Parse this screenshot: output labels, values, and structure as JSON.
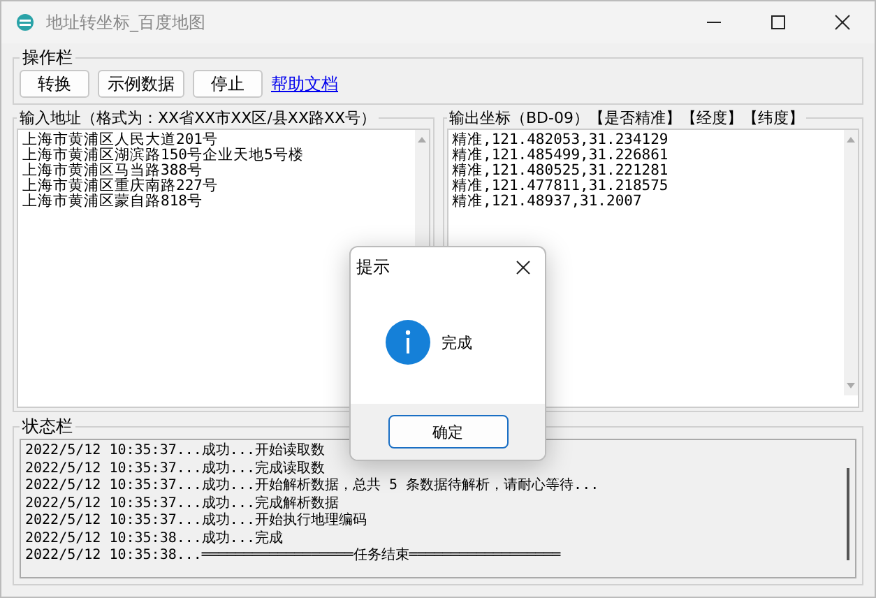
{
  "window": {
    "title": "地址转坐标_百度地图"
  },
  "toolbar": {
    "title": "操作栏",
    "buttons": [
      "转换",
      "示例数据",
      "停止"
    ],
    "link": "帮助文档"
  },
  "input": {
    "title": "输入地址（格式为：XX省XX市XX区/县XX路XX号）",
    "lines": [
      "上海市黄浦区人民大道201号",
      "上海市黄浦区湖滨路150号企业天地5号楼",
      "上海市黄浦区马当路388号",
      "上海市黄浦区重庆南路227号",
      "上海市黄浦区蒙自路818号"
    ]
  },
  "output": {
    "title": "输出坐标（BD-09）【是否精准】【经度】【纬度】",
    "lines": [
      "精准,121.482053,31.234129",
      "精准,121.485499,31.226861",
      "精准,121.480525,31.221281",
      "精准,121.477811,31.218575",
      "精准,121.48937,31.2007"
    ]
  },
  "status": {
    "title": "状态栏",
    "lines": [
      "2022/5/12 10:35:37...成功...开始读取数",
      "2022/5/12 10:35:37...成功...完成读取数",
      "2022/5/12 10:35:37...成功...开始解析数据，总共 5 条数据待解析，请耐心等待...",
      "2022/5/12 10:35:37...成功...完成解析数据",
      "2022/5/12 10:35:37...成功...开始执行地理编码",
      "2022/5/12 10:35:38...成功...完成",
      "2022/5/12 10:35:38...══════════════════任务结束══════════════════"
    ]
  },
  "dialog": {
    "title": "提示",
    "message": "完成",
    "button": "确定"
  }
}
